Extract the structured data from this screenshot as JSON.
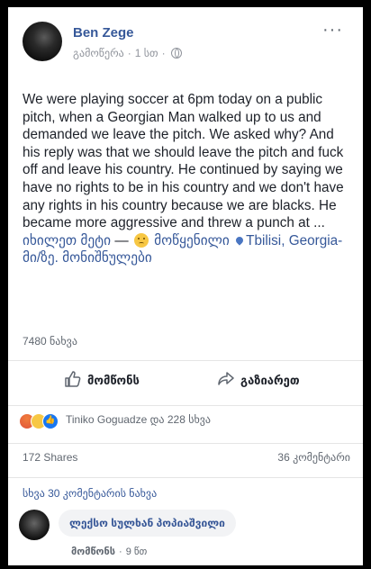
{
  "header": {
    "author": "Ben Zege",
    "status": "გამოწერა",
    "time": "1 სთ",
    "more_icon": "ellipsis-icon",
    "privacy_icon": "globe-icon"
  },
  "post": {
    "lines": [
      "We were playing soccer at 6pm today on a public",
      "pitch, when a Georgian Man walked up to us and",
      "demanded we leave the pitch. We asked why? And",
      "his reply was that we should leave the pitch and fuck",
      "off and leave his country. He continued by saying we",
      "have no rights to be in his country and we don't have",
      "any rights in his country because we are blacks. He",
      "became more aggressive and threw a punch at ..."
    ],
    "see_more": "იხილეთ მეტი",
    "feeling_dash": "—",
    "feeling": "მოწყენილი",
    "location": "Tbilisi, Georgia-",
    "location_line2": "მი/ზე. მონიშნულები"
  },
  "views": "7480 ნახვა",
  "actions": {
    "like": "მომწონს",
    "share": "გაზიარეთ"
  },
  "reactions": {
    "text": "Tiniko Goguadze და 228 სხვა"
  },
  "stats": {
    "shares": "172 Shares",
    "comments": "36 კომენტარი"
  },
  "more_comments": "სხვა 30 კომენტარის ნახვა",
  "comment": {
    "author": "ლექსო სულხან პოპიაშვილი",
    "like": "მომწონს",
    "time": "9 წთ"
  },
  "colors": {
    "link": "#365899",
    "muted": "#90949c",
    "like_blue": "#1877f2"
  }
}
